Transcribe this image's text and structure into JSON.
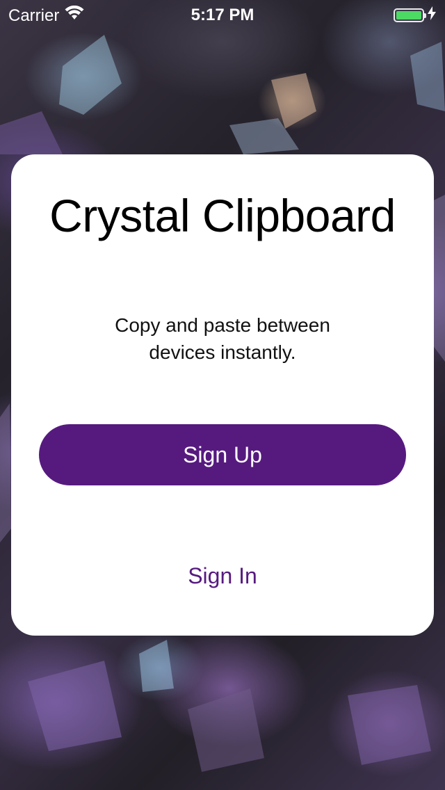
{
  "status_bar": {
    "carrier": "Carrier",
    "time": "5:17 PM",
    "battery_color": "#4cd964",
    "icons": [
      "wifi-icon",
      "battery-icon",
      "charging-bolt-icon"
    ]
  },
  "app": {
    "title": "Crystal Clipboard",
    "tagline": "Copy and paste between devices instantly."
  },
  "actions": {
    "sign_up_label": "Sign Up",
    "sign_in_label": "Sign In"
  },
  "colors": {
    "accent": "#561a7f",
    "card_background": "#ffffff",
    "title_text": "#000000"
  }
}
